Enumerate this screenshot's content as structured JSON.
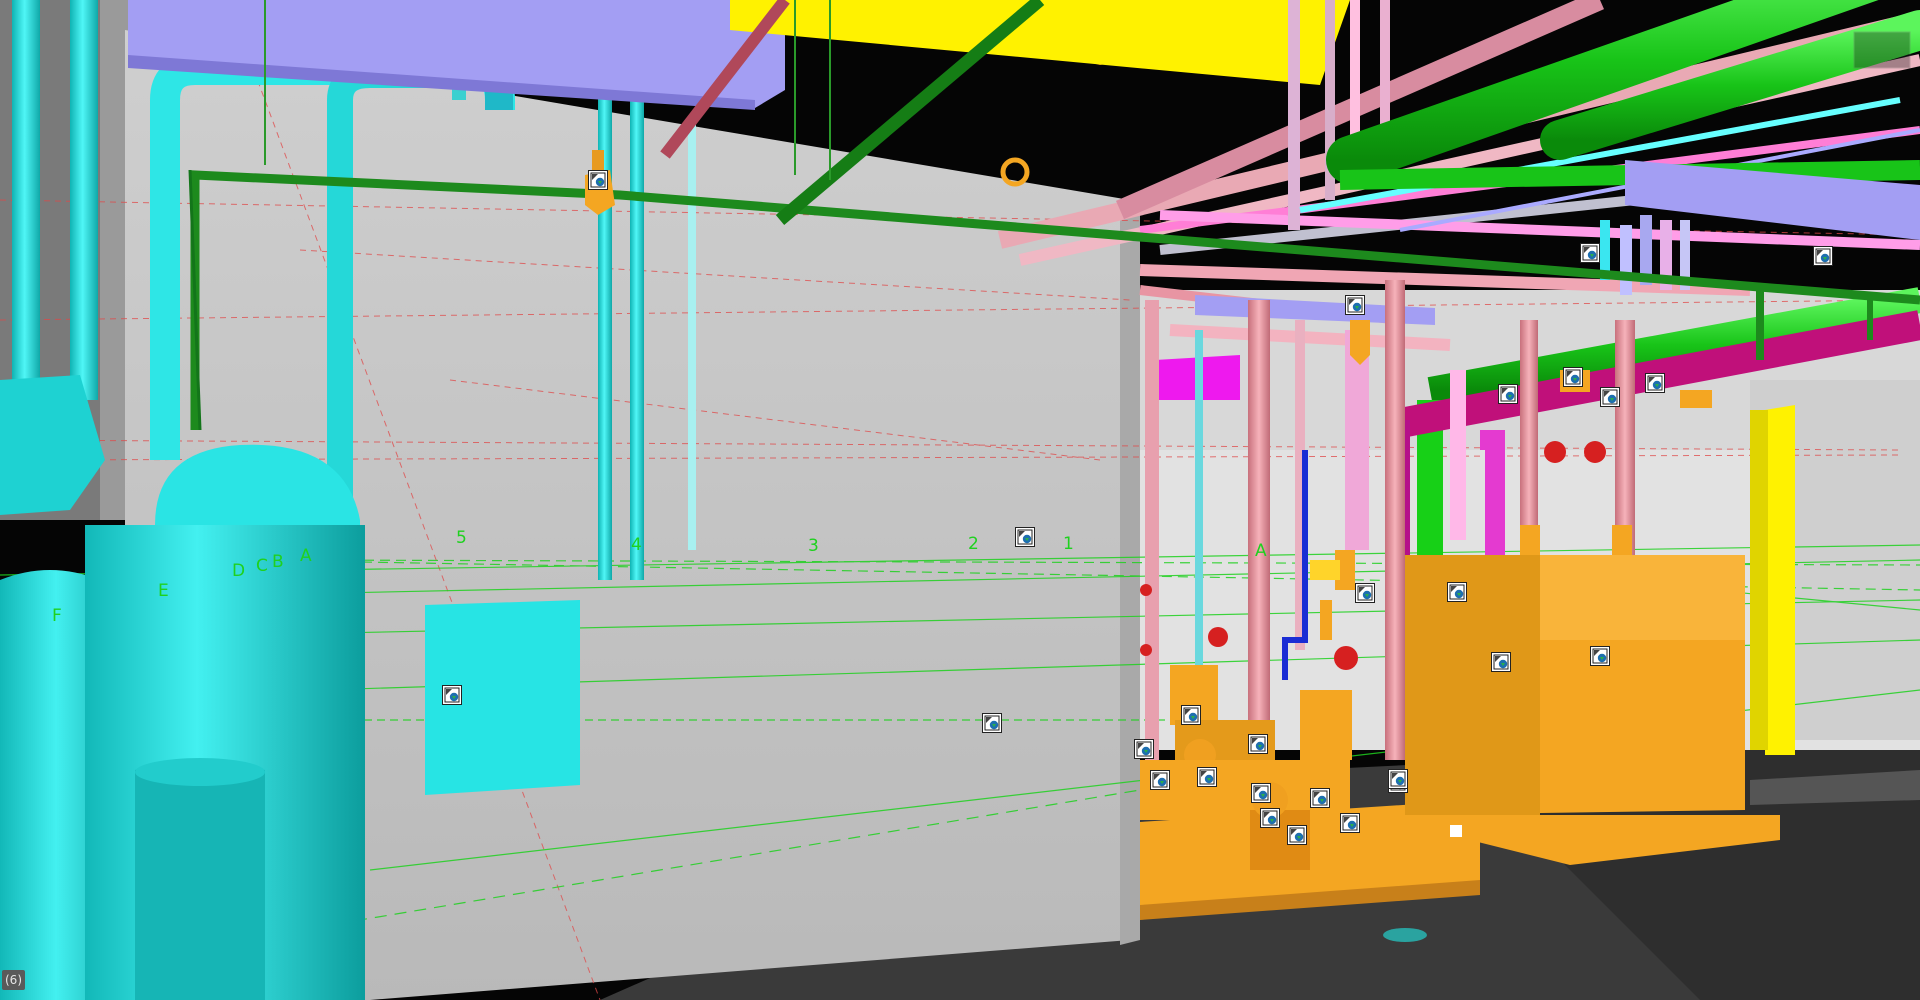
{
  "viewport": {
    "view_badge": "(6)"
  },
  "grid_labels": [
    "5",
    "4",
    "3",
    "2",
    "1",
    "A",
    "D",
    "C",
    "B",
    "A",
    "E",
    "F"
  ],
  "markers": {
    "count": 27,
    "icon": "model-element-tag-icon"
  },
  "colors": {
    "concrete_wall": "#c8c8c8",
    "domestic_water": "#22dddd",
    "sprinkler": "#1d8a1d",
    "chilled_water": "#18cc18",
    "hot_water_return": "#e8909c",
    "hot_water_supply": "#ff6fd8",
    "magenta_main": "#c0107a",
    "duct": "#9f98f0",
    "equipment": "#f4a622",
    "steel": "#ffe600",
    "gridline": "#1fd11f",
    "floor": "#3b3b3b"
  }
}
